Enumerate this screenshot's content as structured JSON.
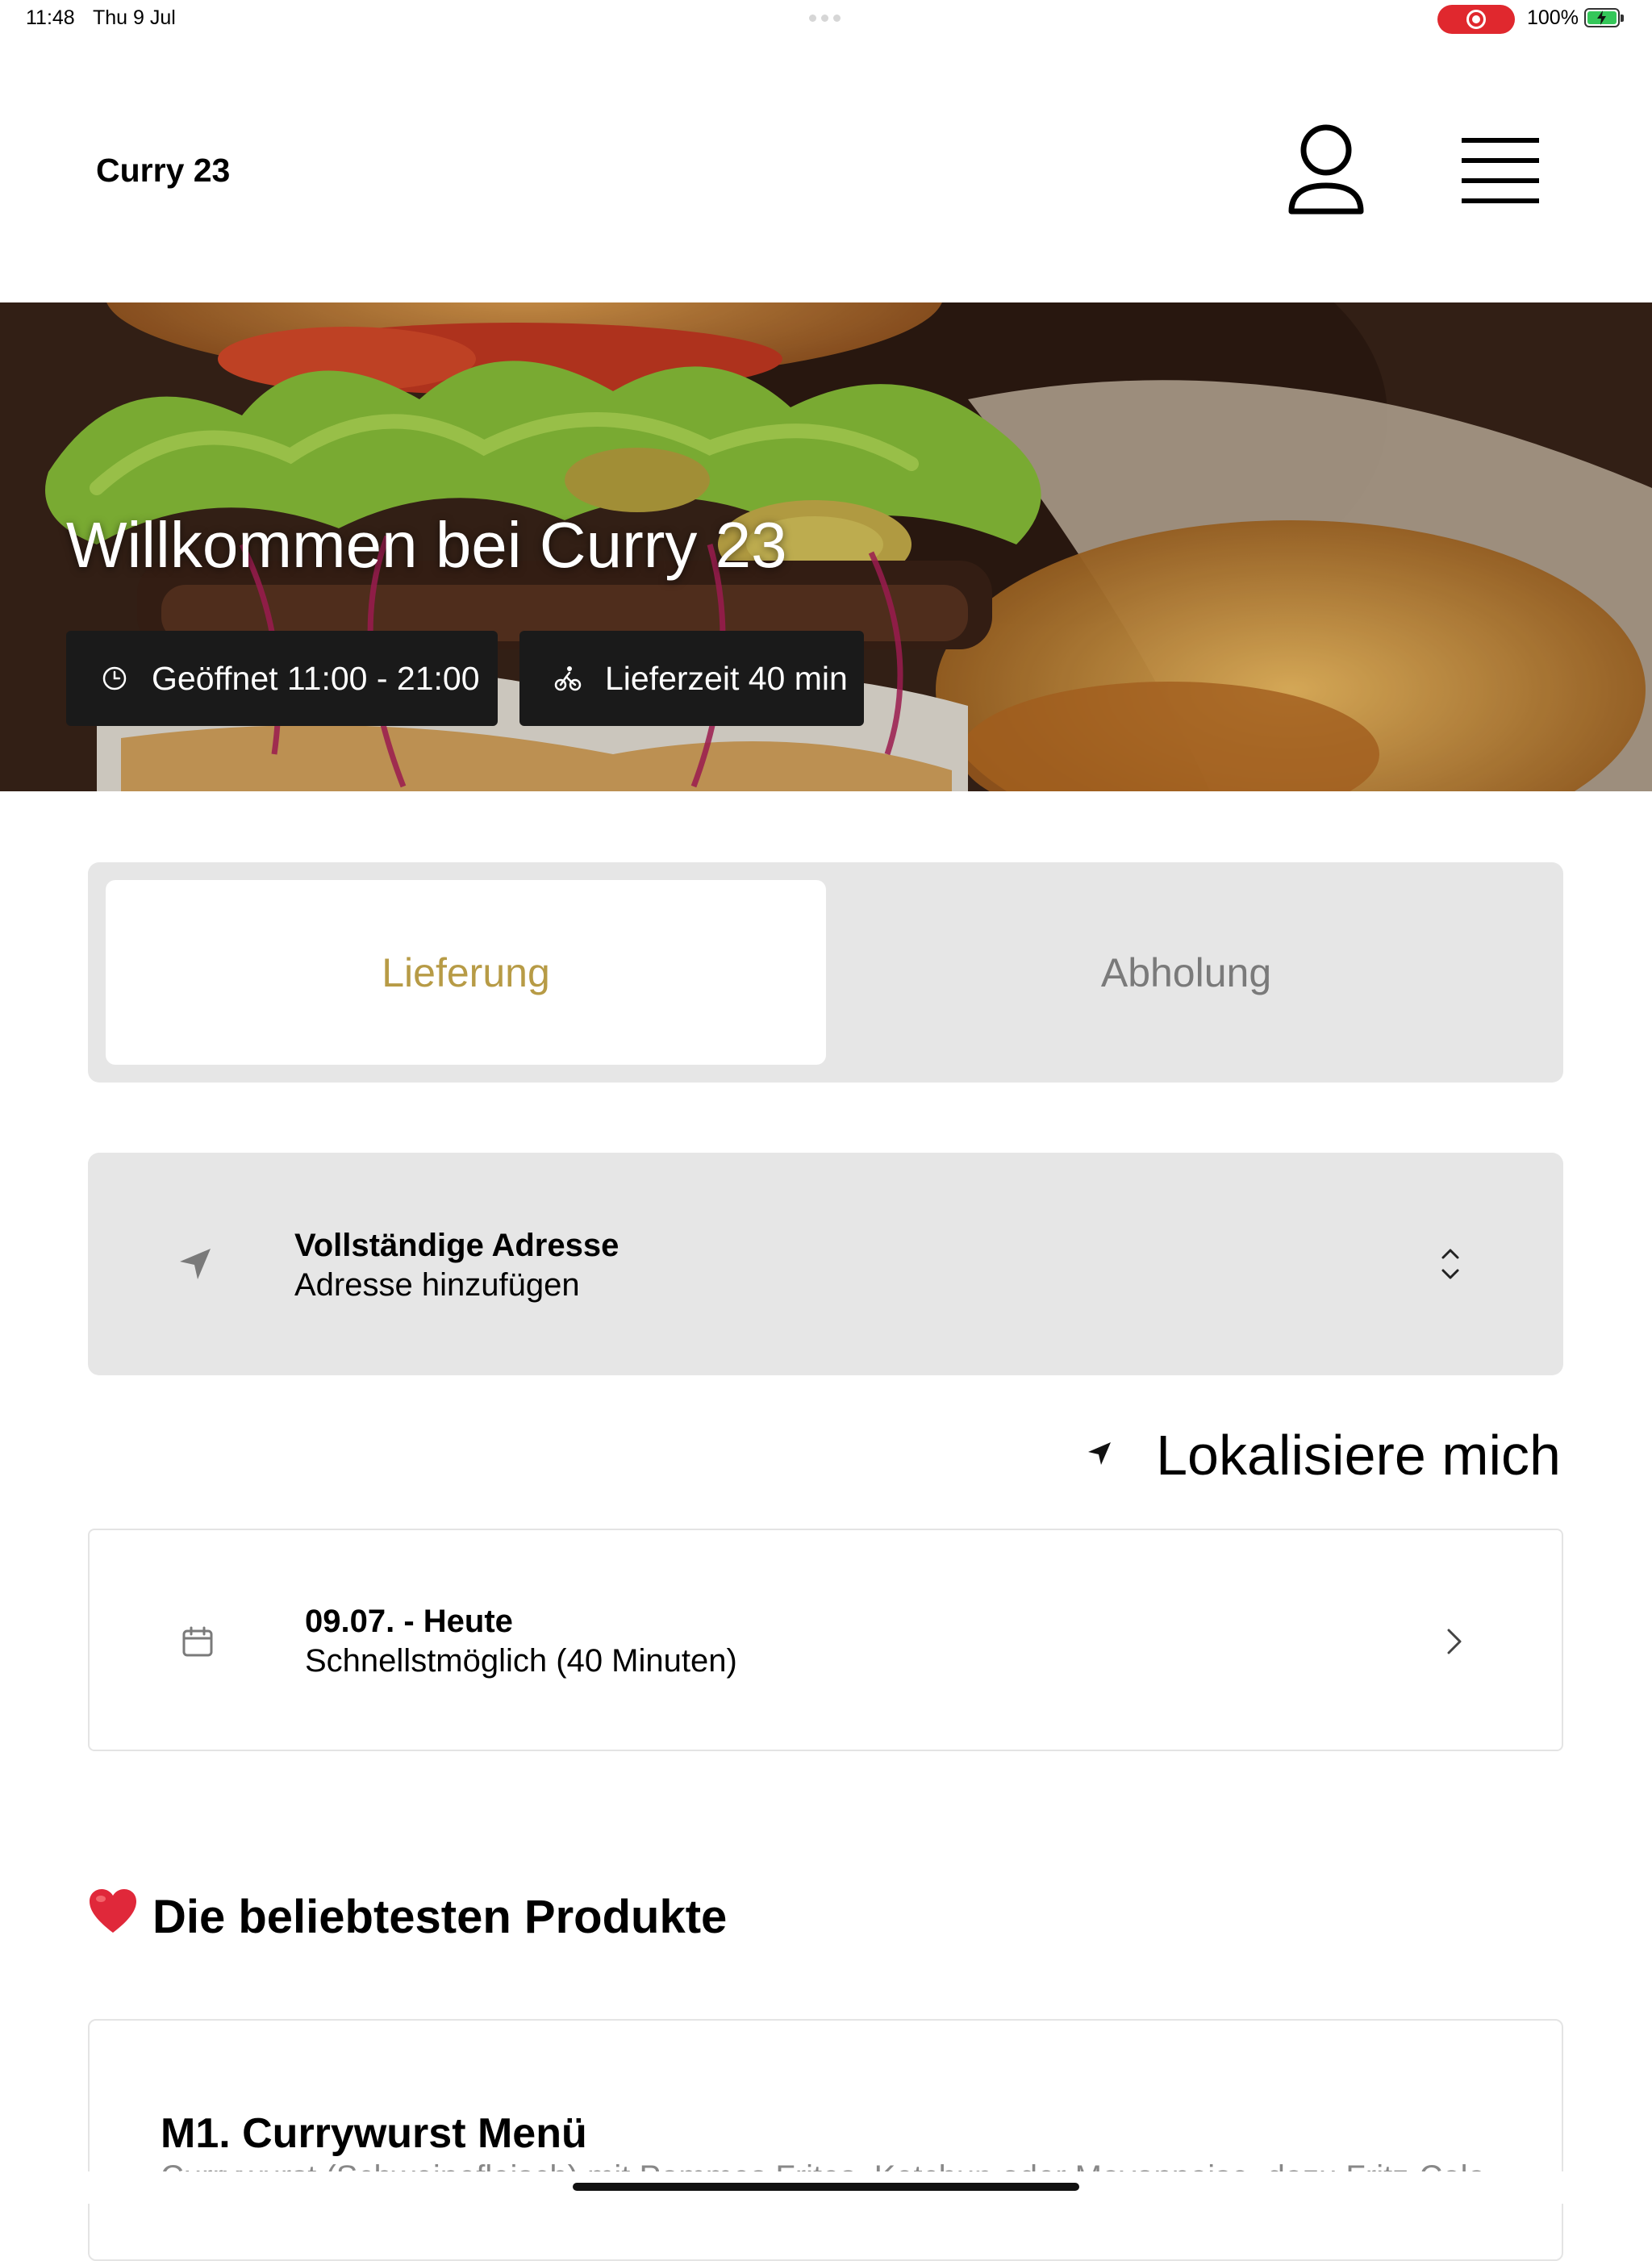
{
  "status_bar": {
    "time": "11:48",
    "date": "Thu 9 Jul",
    "battery": "100%",
    "recording_color": "#e0282e",
    "battery_color": "#34c759"
  },
  "header": {
    "brand": "Curry 23",
    "profile_icon": "person-icon",
    "menu_icon": "hamburger-menu-icon"
  },
  "hero": {
    "title": "Willkommen bei Curry 23",
    "hours_icon": "clock-icon",
    "hours": "Geöffnet 11:00 - 21:00",
    "delivery_icon": "bike-icon",
    "delivery_time": "Lieferzeit 40 min"
  },
  "order_type": {
    "options": [
      "Lieferung",
      "Abholung"
    ],
    "selected": "Lieferung",
    "accent_color": "#b79b46"
  },
  "address": {
    "icon": "navigation-arrow-icon",
    "title": "Vollständige Adresse",
    "value": "Adresse hinzufügen",
    "chevron_icon": "chevron-up-down-icon"
  },
  "locate": {
    "icon": "location-arrow-icon",
    "label": "Lokalisiere mich"
  },
  "schedule": {
    "icon": "calendar-icon",
    "title": "09.07. - Heute",
    "value": "Schnellstmöglich (40 Minuten)",
    "chevron_icon": "chevron-right-icon"
  },
  "popular": {
    "emoji": "❤️",
    "heading": "Die beliebtesten Produkte",
    "products": [
      {
        "name": "M1. Currywurst Menü",
        "description": "Currywurst (Schweinefleisch) mit Pommes Frites, Ketchup oder Mayonnaise, dazu Fritz-Cola"
      }
    ]
  }
}
